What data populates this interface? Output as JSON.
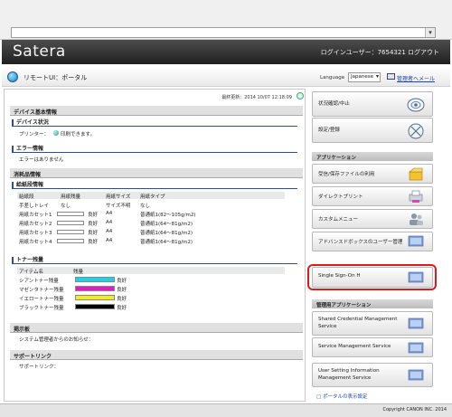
{
  "header": {
    "logo": "Satera",
    "user_info": "ログインユーザー：7654321  ログアウト"
  },
  "subheader": {
    "title": "リモートUI：ポータル",
    "language_label": "Language",
    "language_value": "Japanese",
    "mail_link": "管理者へメール"
  },
  "main": {
    "updated": "最終更新：2014 10/07 12:18:09",
    "device_info": {
      "title": "デバイス基本情報",
      "status_title": "デバイス状況",
      "printer_label": "プリンター：",
      "printer_status": "印刷できます。",
      "error_title": "エラー情報",
      "error_text": "エラーはありません"
    },
    "consumables": {
      "title": "消耗品情報",
      "paper_title": "給紙段情報",
      "paper_headers": [
        "給紙段",
        "用紙残量",
        "用紙サイズ",
        "用紙タイプ"
      ],
      "trays": [
        {
          "name": "手差しトレイ",
          "level": "なし",
          "size": "サイズ不明",
          "type": "なし"
        },
        {
          "name": "用紙カセット1",
          "level": "良好",
          "size": "A4",
          "type": "普通紙1(82〜105g/m2)"
        },
        {
          "name": "用紙カセット2",
          "level": "良好",
          "size": "A4",
          "type": "普通紙1(64〜81g/m2)"
        },
        {
          "name": "用紙カセット3",
          "level": "良好",
          "size": "A4",
          "type": "普通紙1(64〜81g/m2)"
        },
        {
          "name": "用紙カセット4",
          "level": "良好",
          "size": "A4",
          "type": "普通紙1(64〜81g/m2)"
        }
      ],
      "toner_title": "トナー残量",
      "toner_headers": [
        "アイテム名",
        "残量"
      ],
      "toners": [
        {
          "name": "シアントナー残量",
          "status": "良好",
          "color": "#19d3e6"
        },
        {
          "name": "マゼンタトナー残量",
          "status": "良好",
          "color": "#e619c8"
        },
        {
          "name": "イエロートナー残量",
          "status": "良好",
          "color": "#f2ee19"
        },
        {
          "name": "ブラックトナー残量",
          "status": "良好",
          "color": "#000000"
        }
      ]
    },
    "bulletin": {
      "title": "掲示板",
      "text": "システム管理者からのお知らせ："
    },
    "support": {
      "title": "サポートリンク",
      "text": "サポートリンク："
    }
  },
  "right": {
    "status_button": "状況確認/中止",
    "settings_button": "設定/登録",
    "apps_title": "アプリケーション",
    "apps": [
      {
        "label": "受信/保存ファイルの利用"
      },
      {
        "label": "ダイレクトプリント"
      },
      {
        "label": "カスタムメニュー"
      },
      {
        "label": "アドバンスドボックスのユーザー管理"
      },
      {
        "label": "Single Sign-On H"
      }
    ],
    "admin_title": "管理用アプリケーション",
    "admin_apps": [
      {
        "label": "Shared Credential Management Service"
      },
      {
        "label": "Service Management Service"
      },
      {
        "label": "User Setting Information Management Service"
      }
    ],
    "portal_display_link": "ポータルの表示設定"
  },
  "footer": {
    "copyright": "Copyright CANON INC. 2014"
  }
}
